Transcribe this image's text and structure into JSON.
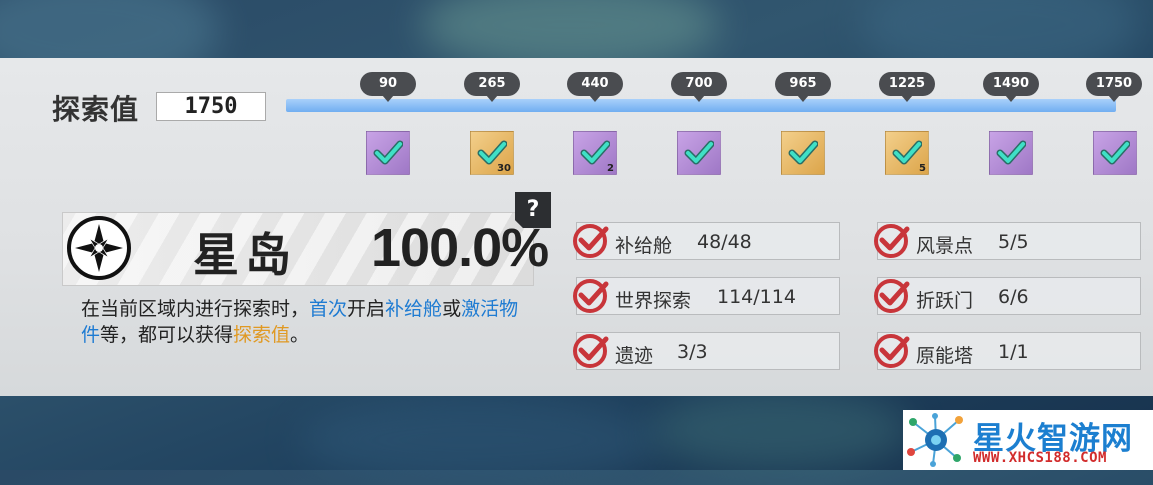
{
  "exploration": {
    "label": "探索值",
    "value": "1750",
    "progress": 1.0
  },
  "milestones": [
    {
      "value": "90",
      "reward_color": "purple",
      "qty": ""
    },
    {
      "value": "265",
      "reward_color": "gold",
      "qty": "30"
    },
    {
      "value": "440",
      "reward_color": "purple",
      "qty": "2"
    },
    {
      "value": "700",
      "reward_color": "purple",
      "qty": ""
    },
    {
      "value": "965",
      "reward_color": "gold",
      "qty": ""
    },
    {
      "value": "1225",
      "reward_color": "gold",
      "qty": "5"
    },
    {
      "value": "1490",
      "reward_color": "purple",
      "qty": ""
    },
    {
      "value": "1750",
      "reward_color": "purple",
      "qty": ""
    }
  ],
  "region": {
    "name": "星岛",
    "percent": "100.0%",
    "help": "?",
    "icon": "compass-star-icon"
  },
  "description": {
    "p1": "在当前区域内进行探索时，",
    "h1": "首次",
    "p2": "开启",
    "h2": "补给舱",
    "p3": "或",
    "h3": "激活物件",
    "p4": "等，都可以获得",
    "h4": "探索值",
    "p5": "。"
  },
  "stats": [
    {
      "label": "补给舱",
      "value": "48/48"
    },
    {
      "label": "风景点",
      "value": "5/5"
    },
    {
      "label": "世界探索",
      "value": "114/114"
    },
    {
      "label": "折跃门",
      "value": "6/6"
    },
    {
      "label": "遗迹",
      "value": "3/3"
    },
    {
      "label": "原能塔",
      "value": "1/1"
    }
  ],
  "watermark": {
    "name": "星火智游网",
    "url": "WWW.XHCS188.COM"
  },
  "colors": {
    "progress_bar": "#71aef1",
    "check_red": "#c8353a",
    "reward_check": "#2fc7b0",
    "highlight_blue": "#1e7bd2",
    "highlight_gold": "#e09922"
  }
}
